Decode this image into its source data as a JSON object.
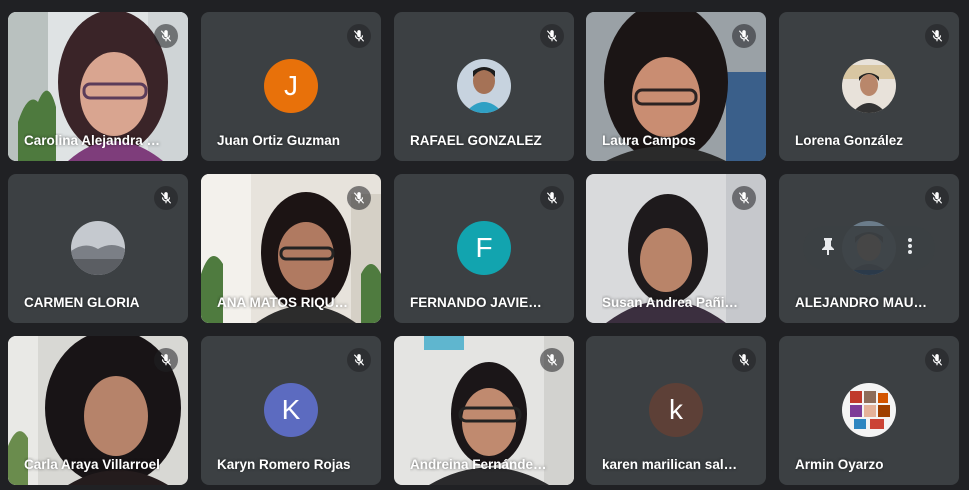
{
  "participants": [
    {
      "name": "Carolina Alejandra C...",
      "type": "video"
    },
    {
      "name": "Juan Ortiz Guzman",
      "type": "initial",
      "initial": "J",
      "color": "#e8710a"
    },
    {
      "name": "RAFAEL GONZALEZ",
      "type": "photo"
    },
    {
      "name": "Laura Campos",
      "type": "video"
    },
    {
      "name": "Lorena González",
      "type": "photo"
    },
    {
      "name": "CARMEN GLORIA",
      "type": "photo"
    },
    {
      "name": "ANA MATOS RIQUEL...",
      "type": "video"
    },
    {
      "name": "FERNANDO JAVIER ...",
      "type": "initial",
      "initial": "F",
      "color": "#12a4af"
    },
    {
      "name": "Susan Andrea Pañin...",
      "type": "video"
    },
    {
      "name": "ALEJANDRO MAURI...",
      "type": "photo"
    },
    {
      "name": "Carla Araya Villarroel",
      "type": "video"
    },
    {
      "name": "Karyn Romero Rojas",
      "type": "initial",
      "initial": "K",
      "color": "#5c6bc0"
    },
    {
      "name": "Andreina Fernández ...",
      "type": "video"
    },
    {
      "name": "karen marilican saldi...",
      "type": "initial",
      "initial": "k",
      "color": "#5d4037"
    },
    {
      "name": "Armin Oyarzo",
      "type": "photo"
    }
  ],
  "icons": {
    "mic_muted": "mic-off-icon",
    "pin": "pin-icon",
    "more": "more-vert-icon"
  },
  "colors": {
    "background": "#202124",
    "tile": "#3c4043"
  }
}
